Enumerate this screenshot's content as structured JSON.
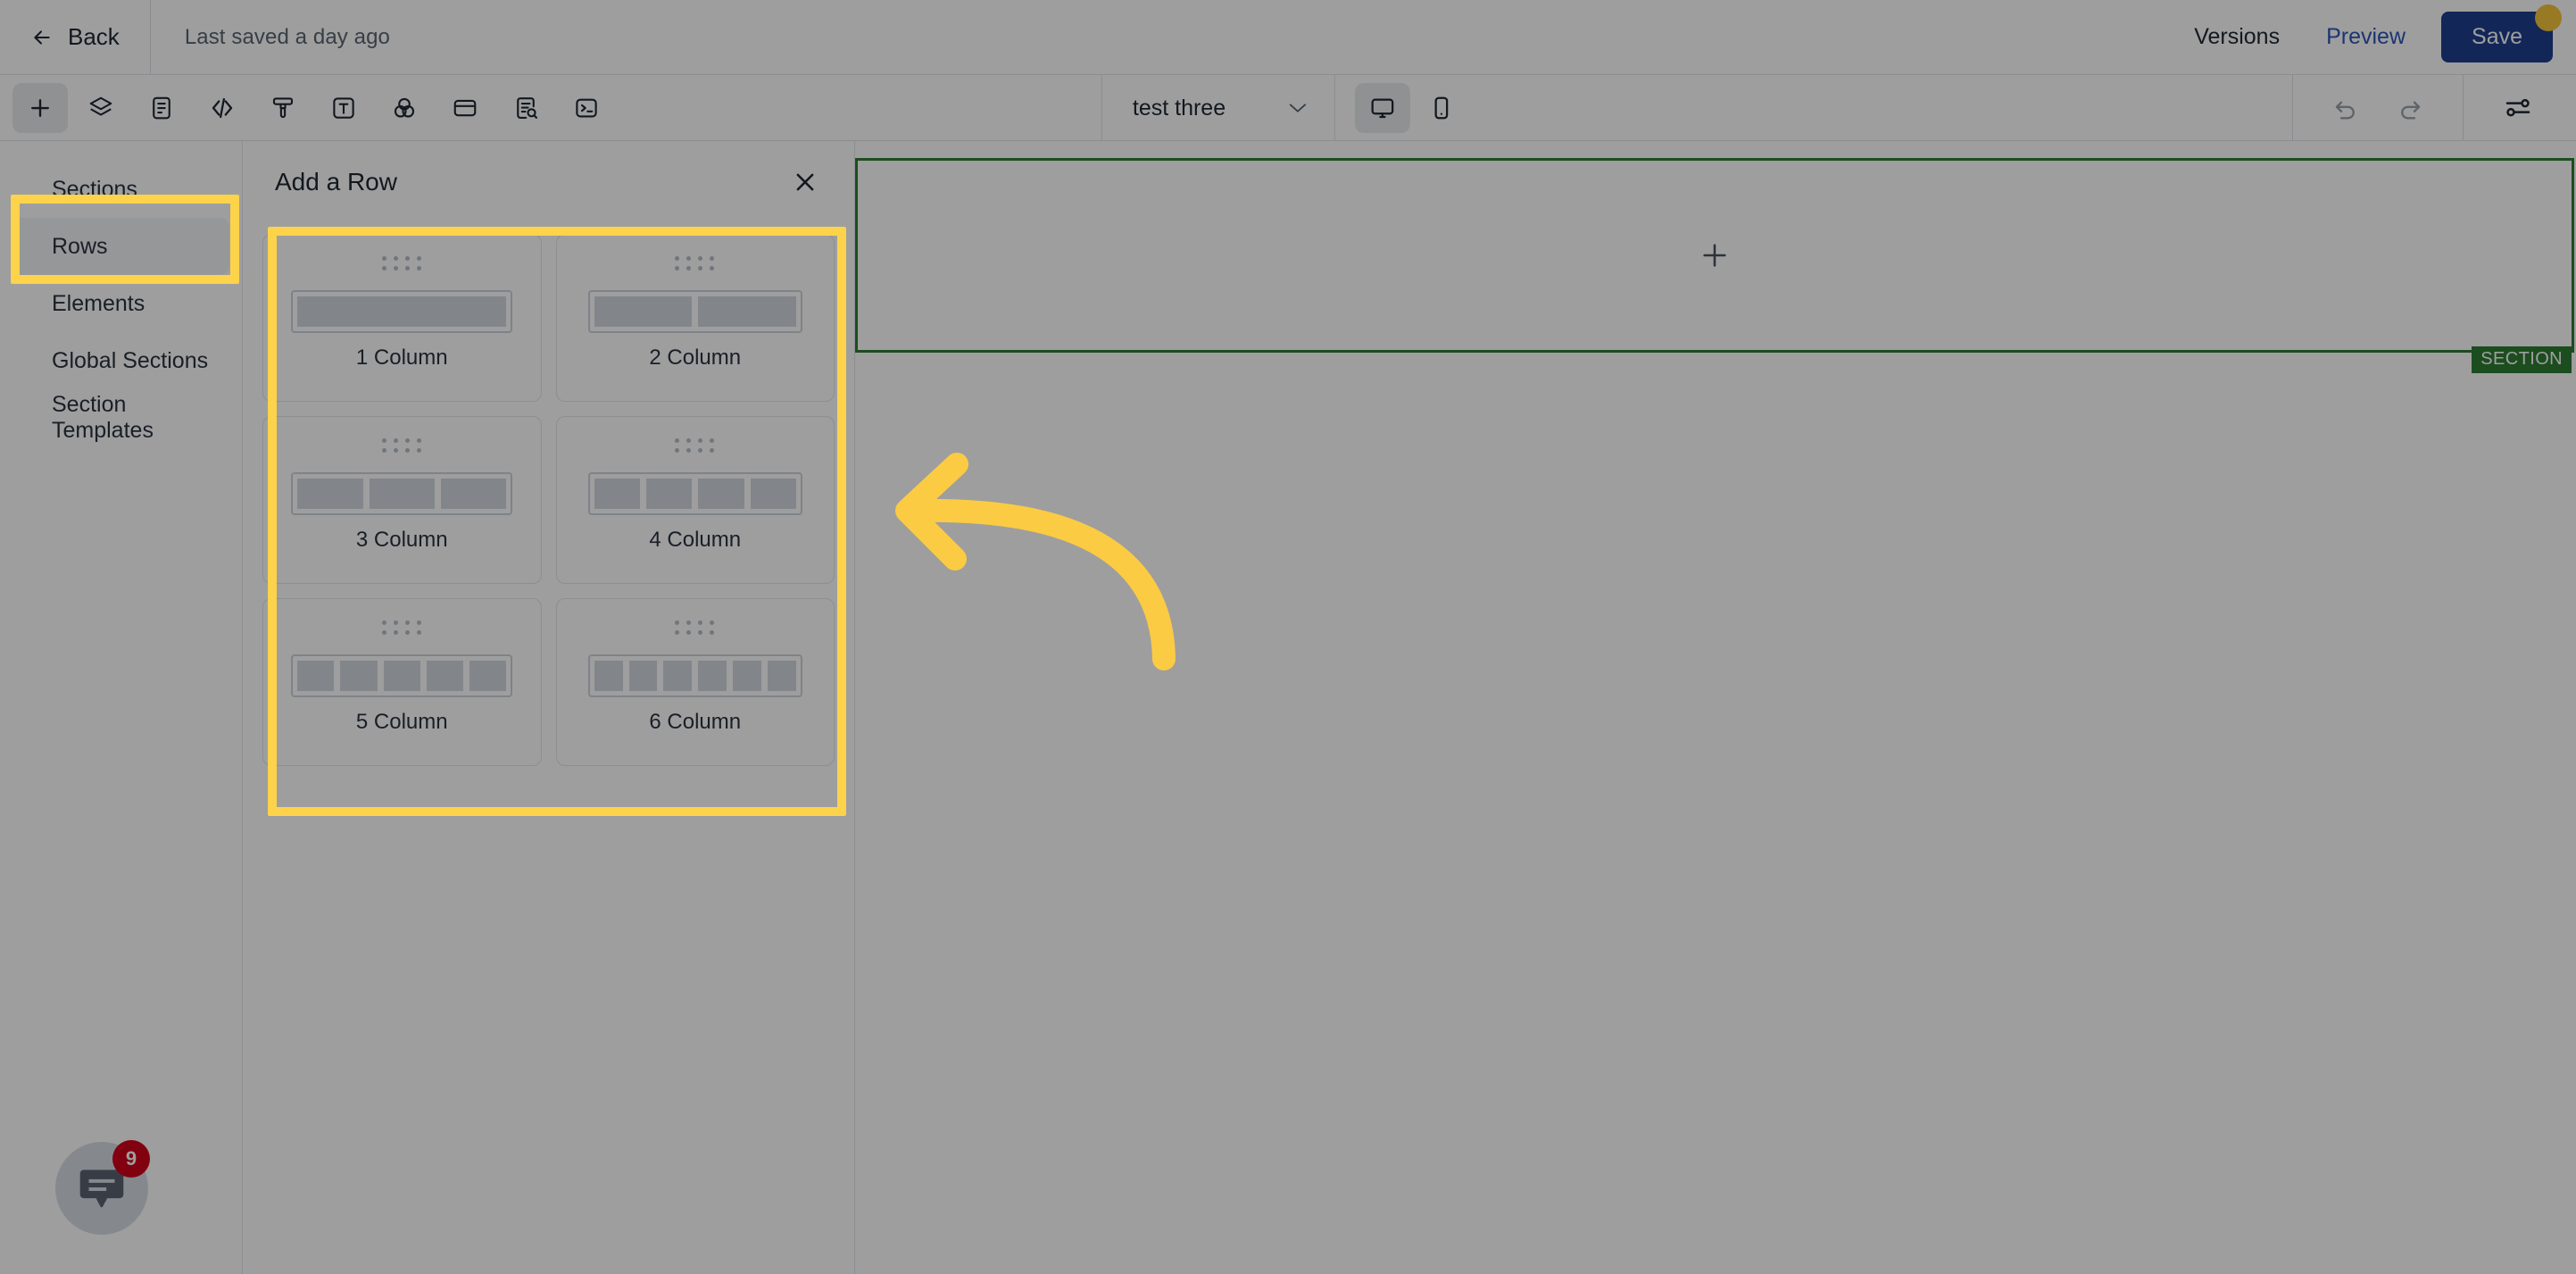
{
  "topbar": {
    "back_label": "Back",
    "last_saved": "Last saved a day ago",
    "versions_label": "Versions",
    "preview_label": "Preview",
    "save_label": "Save"
  },
  "toolbar": {
    "left_tools": [
      {
        "name": "add-icon",
        "label": "Add",
        "active": true
      },
      {
        "name": "layers-icon",
        "label": "Layers",
        "active": false
      },
      {
        "name": "page-content-icon",
        "label": "Page Content",
        "active": false
      },
      {
        "name": "code-icon",
        "label": "Custom Code",
        "active": false
      },
      {
        "name": "brush-icon",
        "label": "Styles",
        "active": false
      },
      {
        "name": "typography-icon",
        "label": "Typography",
        "active": false
      },
      {
        "name": "color-palette-icon",
        "label": "Colors",
        "active": false
      },
      {
        "name": "container-icon",
        "label": "Container",
        "active": false
      },
      {
        "name": "seo-icon",
        "label": "SEO",
        "active": false
      },
      {
        "name": "terminal-icon",
        "label": "Console",
        "active": false
      }
    ],
    "page_select_value": "test three",
    "devices": [
      {
        "name": "desktop-icon",
        "label": "Desktop",
        "active": true
      },
      {
        "name": "mobile-icon",
        "label": "Mobile",
        "active": false
      }
    ],
    "history": [
      {
        "name": "undo-icon",
        "label": "Undo",
        "disabled": true
      },
      {
        "name": "redo-icon",
        "label": "Redo",
        "disabled": true
      }
    ],
    "settings_label": "Settings"
  },
  "sidebar": {
    "items": [
      {
        "label": "Sections",
        "selected": false
      },
      {
        "label": "Rows",
        "selected": true
      },
      {
        "label": "Elements",
        "selected": false
      },
      {
        "label": "Global Sections",
        "selected": false
      },
      {
        "label": "Section Templates",
        "selected": false
      }
    ]
  },
  "panel": {
    "title": "Add a Row",
    "close_label": "Close",
    "rows": [
      {
        "label": "1 Column",
        "columns": 1
      },
      {
        "label": "2 Column",
        "columns": 2
      },
      {
        "label": "3 Column",
        "columns": 3
      },
      {
        "label": "4 Column",
        "columns": 4
      },
      {
        "label": "5 Column",
        "columns": 5
      },
      {
        "label": "6 Column",
        "columns": 6
      }
    ]
  },
  "canvas": {
    "section_badge": "SECTION",
    "add_element_label": "Add element"
  },
  "chat": {
    "unread_count": "9",
    "label": "Open chat"
  },
  "annotations": {
    "highlight_color": "#fcd34a",
    "arrow_color": "#fbcb43",
    "arrow_direction": "left"
  },
  "colors": {
    "accent": "#1f3e8f",
    "link": "#2d56b8",
    "section_outline": "#2e7d32",
    "badge_red": "#d0021b",
    "save_dot": "#f5c33b"
  }
}
